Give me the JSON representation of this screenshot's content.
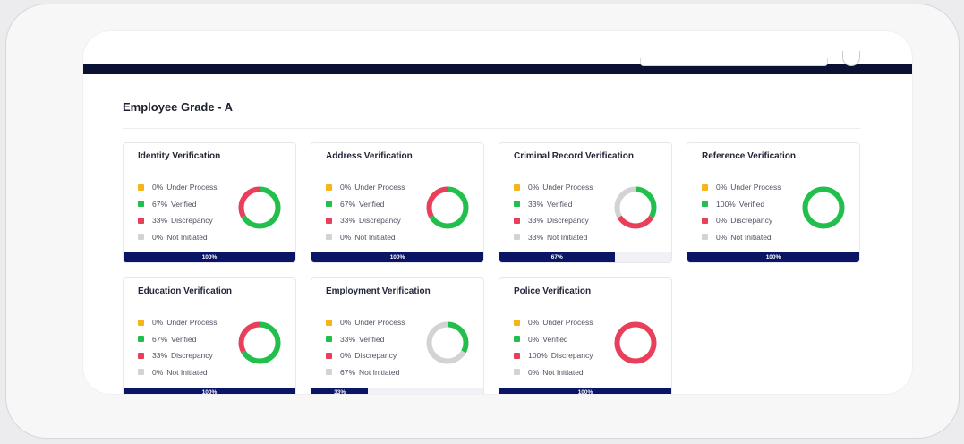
{
  "section_title": "Employee Grade - A",
  "colors": {
    "under_process": "#f6b41a",
    "verified": "#23bf4d",
    "discrepancy": "#e8405a",
    "not_initiated": "#d3d3d6",
    "progress": "#0b1566"
  },
  "cards": [
    {
      "title": "Identity Verification",
      "legend": [
        {
          "pct": "0%",
          "label": "Under Process"
        },
        {
          "pct": "67%",
          "label": "Verified"
        },
        {
          "pct": "33%",
          "label": "Discrepancy"
        },
        {
          "pct": "0%",
          "label": "Not Initiated"
        }
      ],
      "progress_label": "100%",
      "progress_value": 100
    },
    {
      "title": "Address Verification",
      "legend": [
        {
          "pct": "0%",
          "label": "Under Process"
        },
        {
          "pct": "67%",
          "label": "Verified"
        },
        {
          "pct": "33%",
          "label": "Discrepancy"
        },
        {
          "pct": "0%",
          "label": "Not Initiated"
        }
      ],
      "progress_label": "100%",
      "progress_value": 100
    },
    {
      "title": "Criminal Record Verification",
      "legend": [
        {
          "pct": "0%",
          "label": "Under Process"
        },
        {
          "pct": "33%",
          "label": "Verified"
        },
        {
          "pct": "33%",
          "label": "Discrepancy"
        },
        {
          "pct": "33%",
          "label": "Not Initiated"
        }
      ],
      "progress_label": "67%",
      "progress_value": 67
    },
    {
      "title": "Reference Verification",
      "legend": [
        {
          "pct": "0%",
          "label": "Under Process"
        },
        {
          "pct": "100%",
          "label": "Verified"
        },
        {
          "pct": "0%",
          "label": "Discrepancy"
        },
        {
          "pct": "0%",
          "label": "Not Initiated"
        }
      ],
      "progress_label": "100%",
      "progress_value": 100
    },
    {
      "title": "Education Verification",
      "legend": [
        {
          "pct": "0%",
          "label": "Under Process"
        },
        {
          "pct": "67%",
          "label": "Verified"
        },
        {
          "pct": "33%",
          "label": "Discrepancy"
        },
        {
          "pct": "0%",
          "label": "Not Initiated"
        }
      ],
      "progress_label": "100%",
      "progress_value": 100
    },
    {
      "title": "Employment Verification",
      "legend": [
        {
          "pct": "0%",
          "label": "Under Process"
        },
        {
          "pct": "33%",
          "label": "Verified"
        },
        {
          "pct": "0%",
          "label": "Discrepancy"
        },
        {
          "pct": "67%",
          "label": "Not Initiated"
        }
      ],
      "progress_label": "33%",
      "progress_value": 33
    },
    {
      "title": "Police Verification",
      "legend": [
        {
          "pct": "0%",
          "label": "Under Process"
        },
        {
          "pct": "0%",
          "label": "Verified"
        },
        {
          "pct": "100%",
          "label": "Discrepancy"
        },
        {
          "pct": "0%",
          "label": "Not Initiated"
        }
      ],
      "progress_label": "100%",
      "progress_value": 100
    }
  ]
}
